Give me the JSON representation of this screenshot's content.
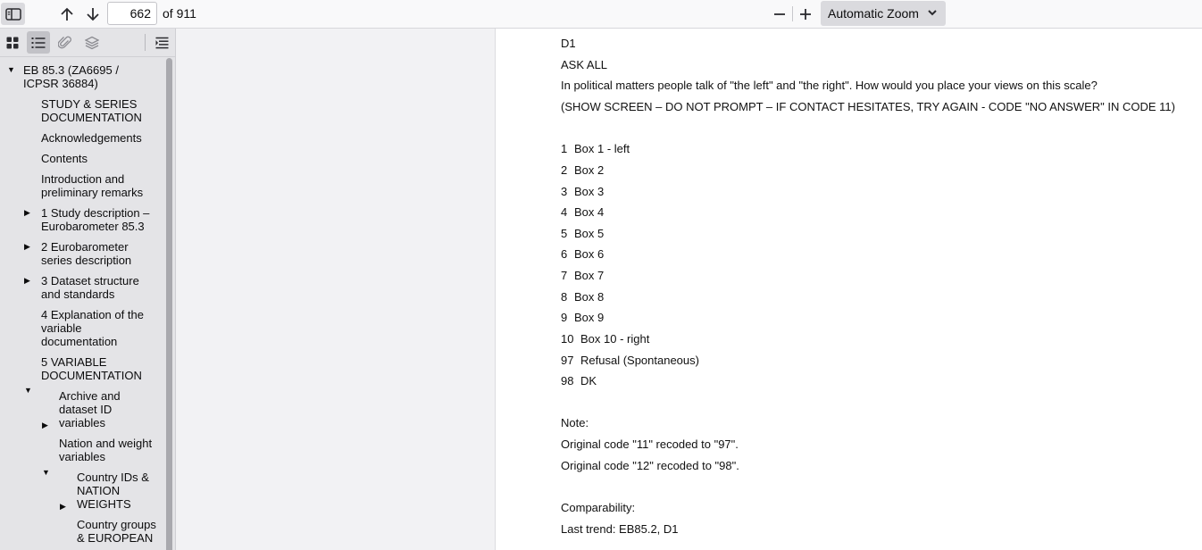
{
  "toolbar": {
    "page_number": "662",
    "page_count": "of 911",
    "zoom_label": "Automatic Zoom"
  },
  "outline": {
    "items": [
      {
        "text": "EB 85.3 (ZA6695 / ICPSR 36884)",
        "level": 0,
        "twisty": "open"
      },
      {
        "text": "STUDY & SERIES DOCUMENTATION",
        "level": 1,
        "twisty": "none"
      },
      {
        "text": "Acknowledgements",
        "level": 1,
        "twisty": "none"
      },
      {
        "text": "Contents",
        "level": 1,
        "twisty": "none"
      },
      {
        "text": "Introduction and preliminary remarks",
        "level": 1,
        "twisty": "none"
      },
      {
        "text": "1 Study description – Eurobarometer 85.3",
        "level": 1,
        "twisty": "closed"
      },
      {
        "text": "2 Eurobarometer series description",
        "level": 1,
        "twisty": "closed"
      },
      {
        "text": "3 Dataset structure and standards",
        "level": 1,
        "twisty": "closed"
      },
      {
        "text": "4 Explanation of the variable documentation",
        "level": 1,
        "twisty": "none"
      },
      {
        "text": "5 VARIABLE DOCUMENTATION",
        "level": 1,
        "twisty": "open"
      },
      {
        "text": "Archive and dataset ID variables",
        "level": 2,
        "twisty": "closed"
      },
      {
        "text": "Nation and weight variables",
        "level": 2,
        "twisty": "open"
      },
      {
        "text": "Country IDs & NATION WEIGHTS",
        "level": 3,
        "twisty": "closed"
      },
      {
        "text": "Country groups & EUROPEAN",
        "level": 3,
        "twisty": "closed"
      }
    ]
  },
  "document": {
    "variable": "D1",
    "filter": "ASK ALL",
    "question": "In political matters people talk of \"the left\" and \"the right\". How would you place your views on this scale?",
    "instruction": "(SHOW SCREEN – DO NOT PROMPT – IF CONTACT HESITATES, TRY AGAIN - CODE \"NO ANSWER\" IN CODE 11)",
    "codes": [
      {
        "code": "1",
        "label": "Box 1 - left"
      },
      {
        "code": "2",
        "label": "Box 2"
      },
      {
        "code": "3",
        "label": "Box 3"
      },
      {
        "code": "4",
        "label": "Box 4"
      },
      {
        "code": "5",
        "label": "Box 5"
      },
      {
        "code": "6",
        "label": "Box 6"
      },
      {
        "code": "7",
        "label": "Box 7"
      },
      {
        "code": "8",
        "label": "Box 8"
      },
      {
        "code": "9",
        "label": "Box 9"
      },
      {
        "code": "10",
        "label": "Box 10 - right"
      },
      {
        "code": "97",
        "label": "Refusal (Spontaneous)"
      },
      {
        "code": "98",
        "label": "DK"
      }
    ],
    "note_heading": "Note:",
    "notes": [
      "Original code \"11\" recoded to \"97\".",
      "Original code \"12\" recoded to \"98\"."
    ],
    "comparability_heading": "Comparability:",
    "last_trend": "Last trend: EB85.2, D1"
  }
}
